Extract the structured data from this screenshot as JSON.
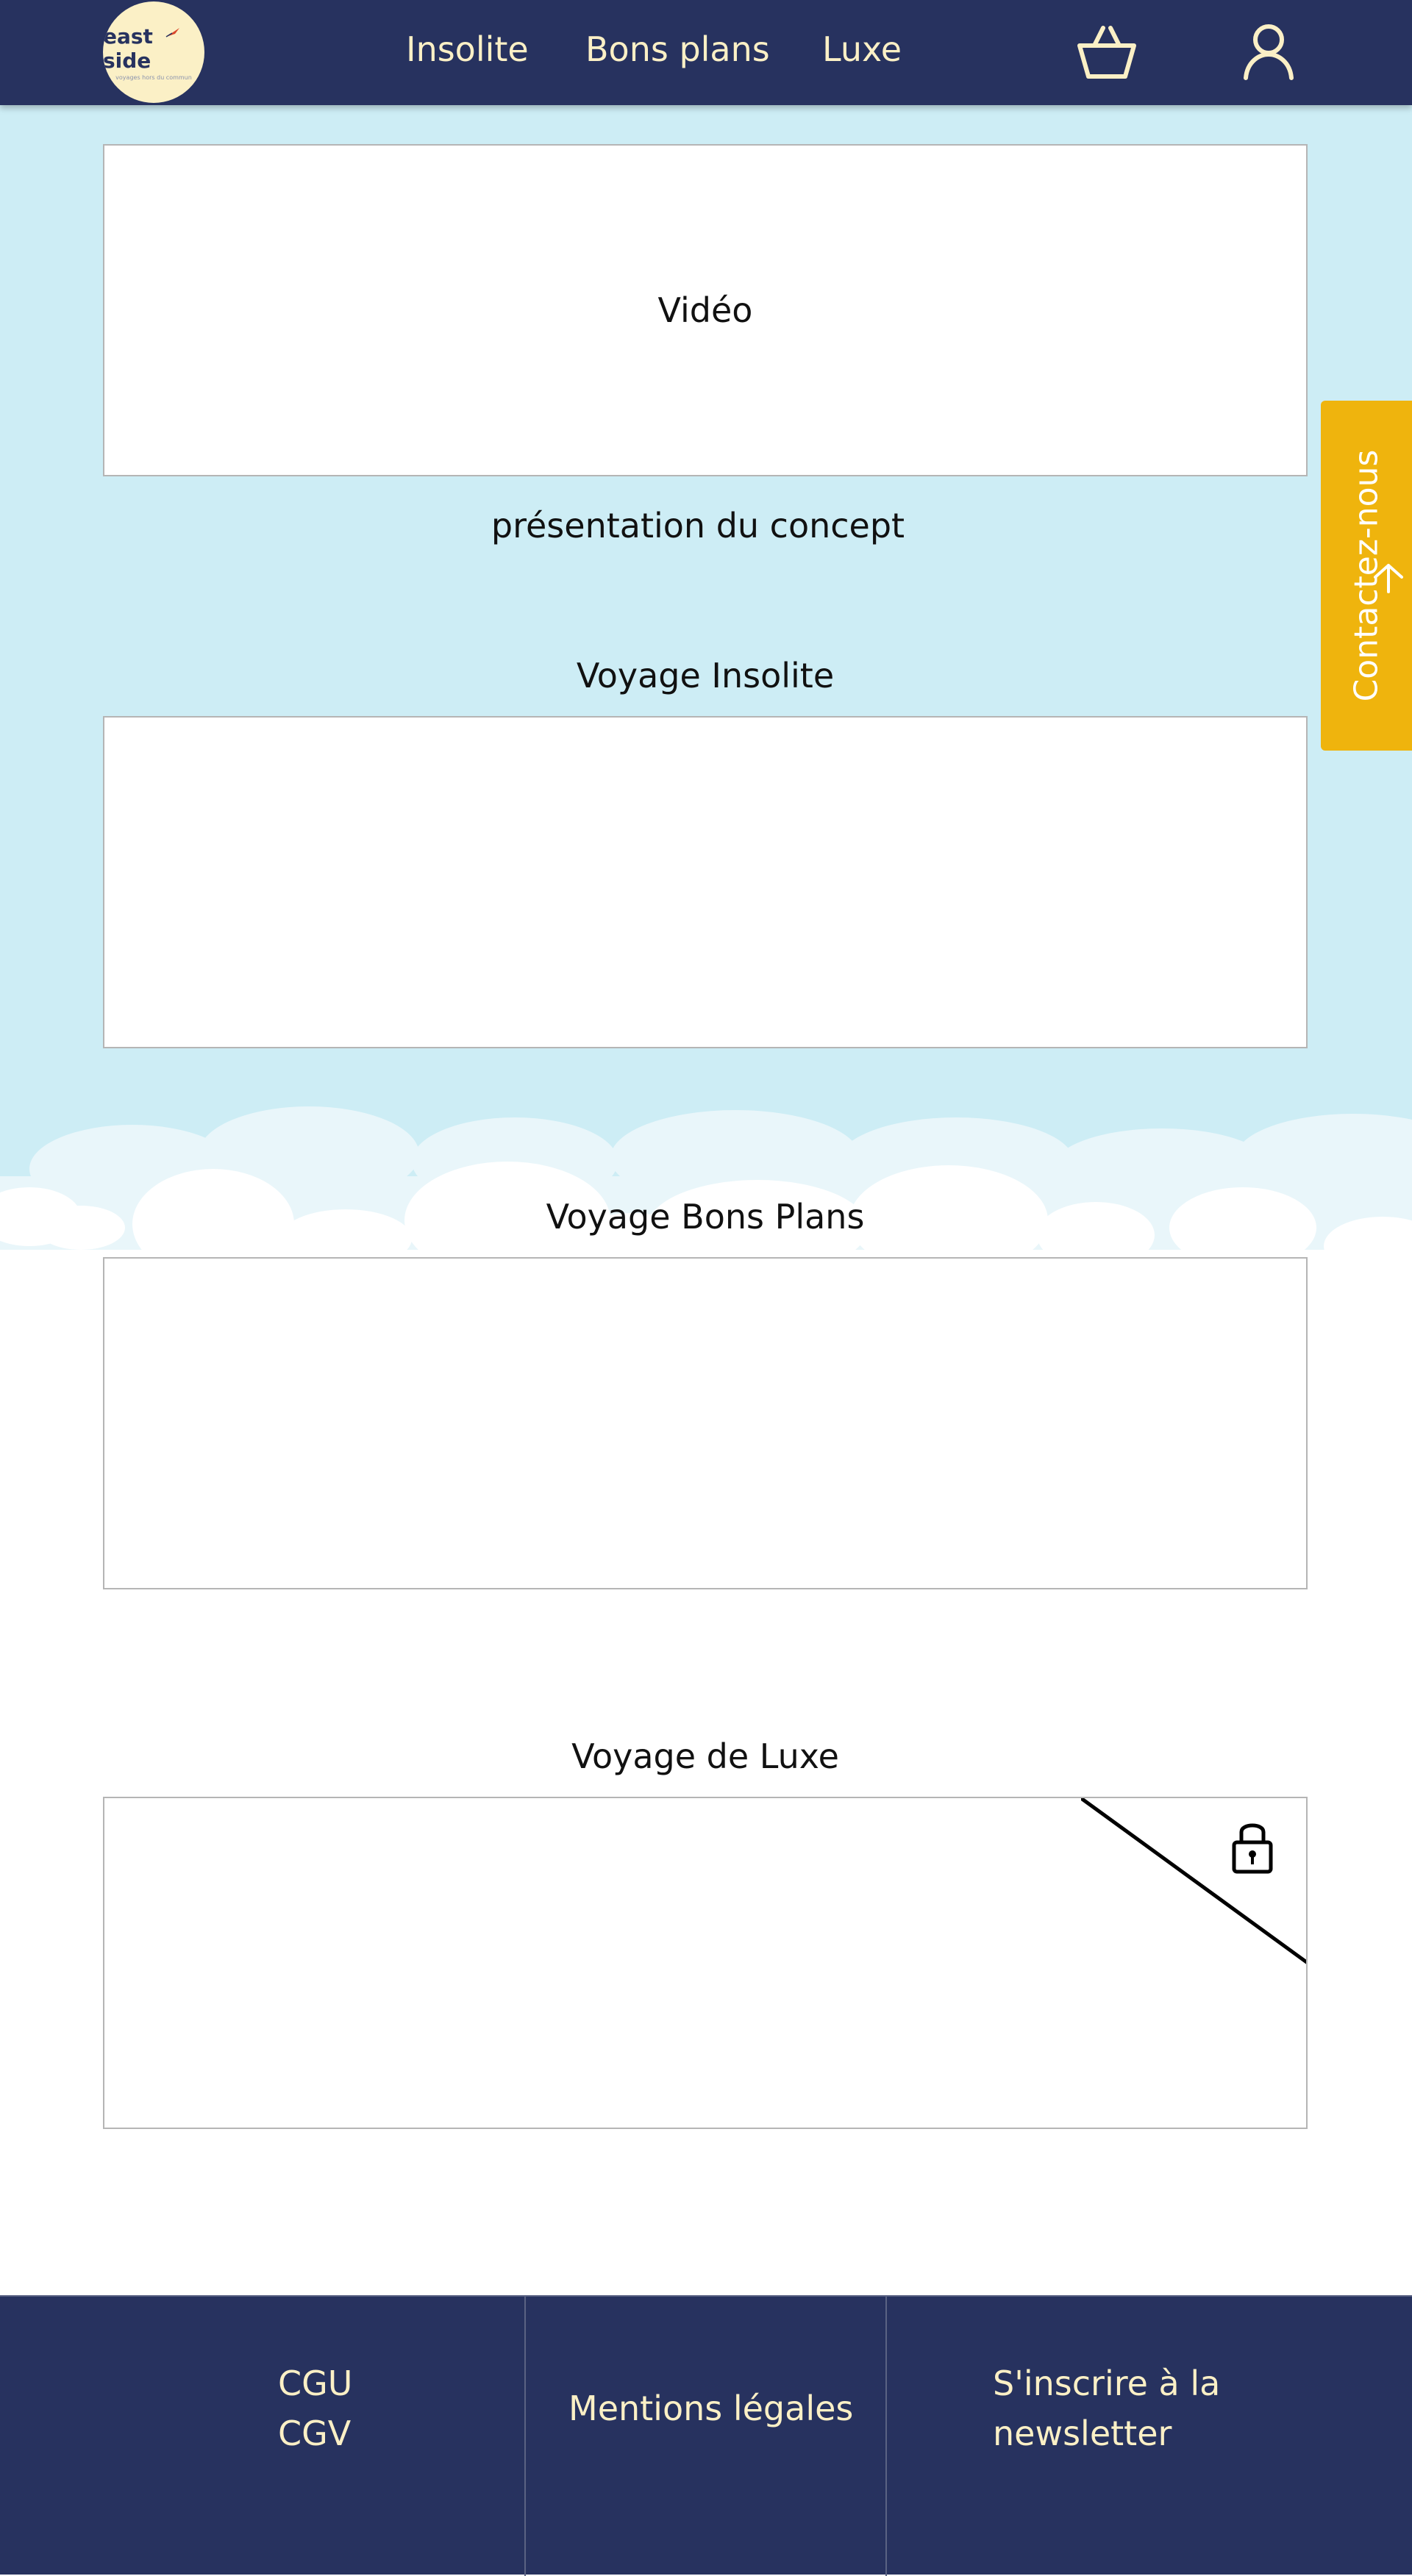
{
  "colors": {
    "header_bg": "#27325f",
    "nav_text": "#fbf0c6",
    "sky": "#cdedf5",
    "contact_bg": "#efb40d",
    "footer_bg": "#27325f"
  },
  "header": {
    "logo": {
      "text": "east side",
      "tagline": "voyages hors du commun",
      "icon": "plane-icon"
    },
    "nav": [
      "Insolite",
      "Bons plans",
      "Luxe"
    ],
    "icons": [
      "basket-icon",
      "user-icon"
    ]
  },
  "main": {
    "video": {
      "label": "Vidéo"
    },
    "concept": "présentation du concept",
    "sections": [
      {
        "title": "Voyage Insolite"
      },
      {
        "title": "Voyage Bons Plans"
      },
      {
        "title": "Voyage de Luxe",
        "icon": "lock-icon"
      }
    ]
  },
  "contact": {
    "label": "Contactez-nous",
    "icon": "arrow-up-icon"
  },
  "footer": {
    "col1": [
      "CGU",
      "CGV"
    ],
    "col2": "Mentions légales",
    "col3": [
      "S'inscrire à la",
      "newsletter"
    ]
  }
}
